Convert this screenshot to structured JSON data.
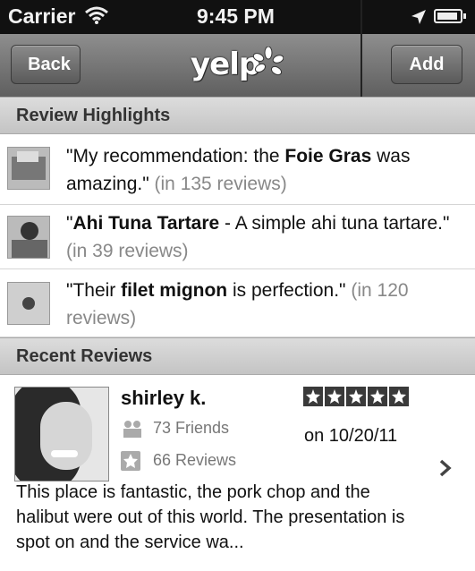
{
  "status": {
    "carrier": "Carrier",
    "time": "9:45 PM",
    "wifi_icon": "wifi-icon",
    "location_icon": "location-arrow-icon",
    "battery_icon": "battery-icon"
  },
  "nav": {
    "back_label": "Back",
    "add_label": "Add",
    "logo_text": "yelp"
  },
  "highlights": {
    "header": "Review Highlights",
    "items": [
      {
        "prefix": "\"My recommendation: the ",
        "bold": "Foie Gras",
        "suffix": " was amazing.\"",
        "count": "(in 135 reviews)"
      },
      {
        "prefix": "\"",
        "bold": "Ahi Tuna Tartare",
        "suffix": " - A simple ahi tuna tartare.\"",
        "count": "(in 39 reviews)"
      },
      {
        "prefix": "\"Their ",
        "bold": "filet mignon",
        "suffix": " is perfection.\"",
        "count": "(in 120 reviews)"
      }
    ]
  },
  "recent": {
    "header": "Recent Reviews",
    "review": {
      "name": "shirley k.",
      "friends": "73 Friends",
      "reviews": "66 Reviews",
      "date": "on 10/20/11",
      "rating": 5,
      "text": "This place is fantastic, the pork chop and the halibut  were out of this world.  The presentation is spot on and the service wa..."
    }
  },
  "colors": {
    "navbar": "#6e6e6e",
    "section_header": "#cfcfcf",
    "count_text": "#888888"
  }
}
